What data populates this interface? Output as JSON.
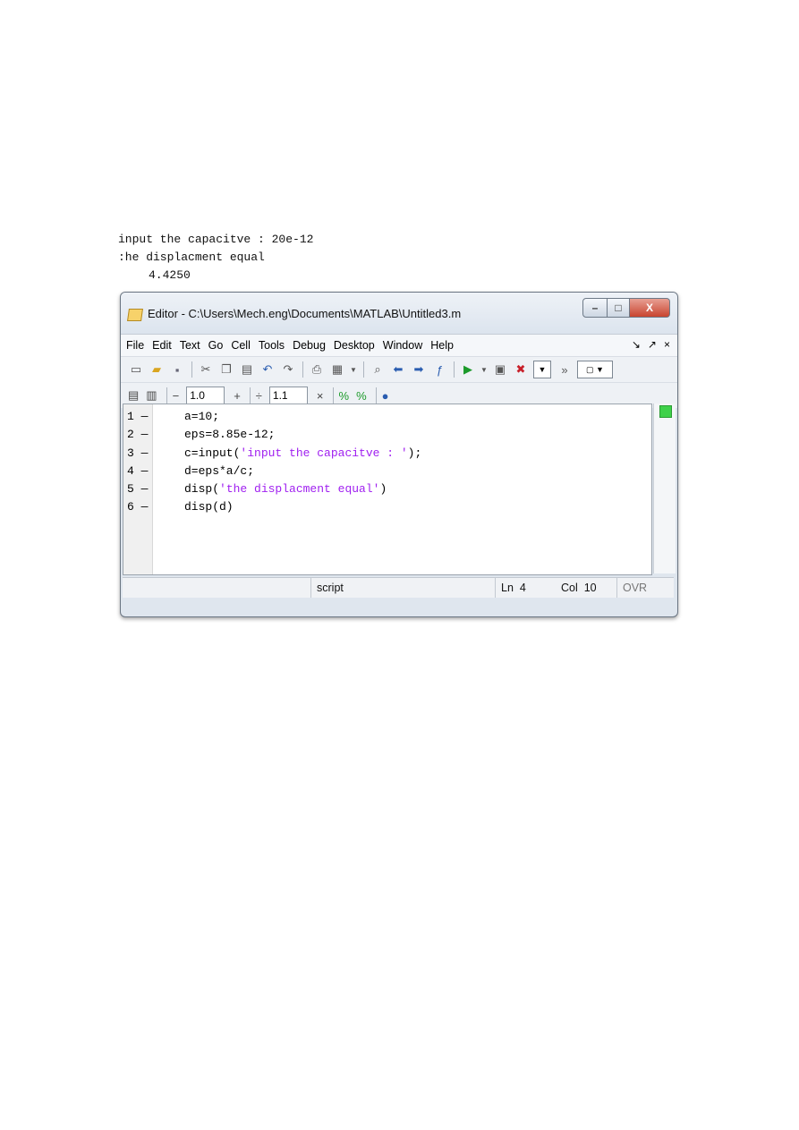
{
  "console": {
    "lines": [
      "input the capacitve : 20e-12",
      ":he displacment equal"
    ],
    "value": "4.4250"
  },
  "window": {
    "title": "Editor - C:\\Users\\Mech.eng\\Documents\\MATLAB\\Untitled3.m",
    "buttons": {
      "minimize": "–",
      "maximize": "□",
      "close": "X"
    }
  },
  "menu": {
    "items": [
      "File",
      "Edit",
      "Text",
      "Go",
      "Cell",
      "Tools",
      "Debug",
      "Desktop",
      "Window",
      "Help"
    ],
    "right": [
      "↘",
      "↗",
      "×"
    ]
  },
  "toolbar2": {
    "minus": "−",
    "value1": "1.0",
    "plus": "+",
    "divide": "÷",
    "value2": "1.1",
    "times": "×"
  },
  "code": {
    "lines": [
      {
        "num": "1",
        "marker": "—",
        "text": "a=10;"
      },
      {
        "num": "2",
        "marker": "—",
        "text": "eps=8.85e-12;"
      },
      {
        "num": "3",
        "marker": "—",
        "pre": "c=input(",
        "str": "'input the capacitve : '",
        "post": ");"
      },
      {
        "num": "4",
        "marker": "—",
        "text": "d=eps*a/c;"
      },
      {
        "num": "5",
        "marker": "—",
        "pre": "disp(",
        "str": "'the displacment equal'",
        "post": ")"
      },
      {
        "num": "6",
        "marker": "—",
        "text": "disp(d)"
      }
    ]
  },
  "status": {
    "type": "script",
    "ln_label": "Ln",
    "ln": "4",
    "col_label": "Col",
    "col": "10",
    "mode": "OVR"
  },
  "colors": {
    "string": "#a020f0",
    "close_button": "#c8442f"
  }
}
